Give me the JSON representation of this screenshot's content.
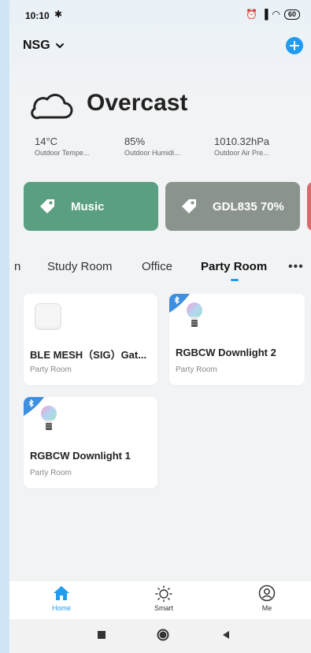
{
  "status_bar": {
    "time": "10:10",
    "battery": "60"
  },
  "header": {
    "home_name": "NSG"
  },
  "weather": {
    "condition": "Overcast",
    "stats": [
      {
        "value": "14°C",
        "label": "Outdoor Tempe..."
      },
      {
        "value": "85%",
        "label": "Outdoor Humidi..."
      },
      {
        "value": "1010.32hPa",
        "label": "Outdoor Air Pre..."
      }
    ]
  },
  "scenes": [
    {
      "label": "Music",
      "color": "#5a9f82"
    },
    {
      "label": "GDL835 70%",
      "color": "#8b948c"
    }
  ],
  "rooms": {
    "tabs": [
      "n",
      "Study Room",
      "Office",
      "Party Room"
    ],
    "active": "Party Room"
  },
  "devices": [
    {
      "name": "BLE MESH（SIG）Gat...",
      "room": "Party Room",
      "icon": "gateway-icon",
      "bluetooth": false
    },
    {
      "name": "RGBCW Downlight 2",
      "room": "Party Room",
      "icon": "bulb-icon",
      "bluetooth": true
    },
    {
      "name": "RGBCW Downlight 1",
      "room": "Party Room",
      "icon": "bulb-icon",
      "bluetooth": true
    }
  ],
  "bottom_nav": [
    {
      "label": "Home",
      "icon": "home-icon",
      "active": true
    },
    {
      "label": "Smart",
      "icon": "sun-icon",
      "active": false
    },
    {
      "label": "Me",
      "icon": "profile-icon",
      "active": false
    }
  ],
  "colors": {
    "accent": "#1f9bf0"
  }
}
